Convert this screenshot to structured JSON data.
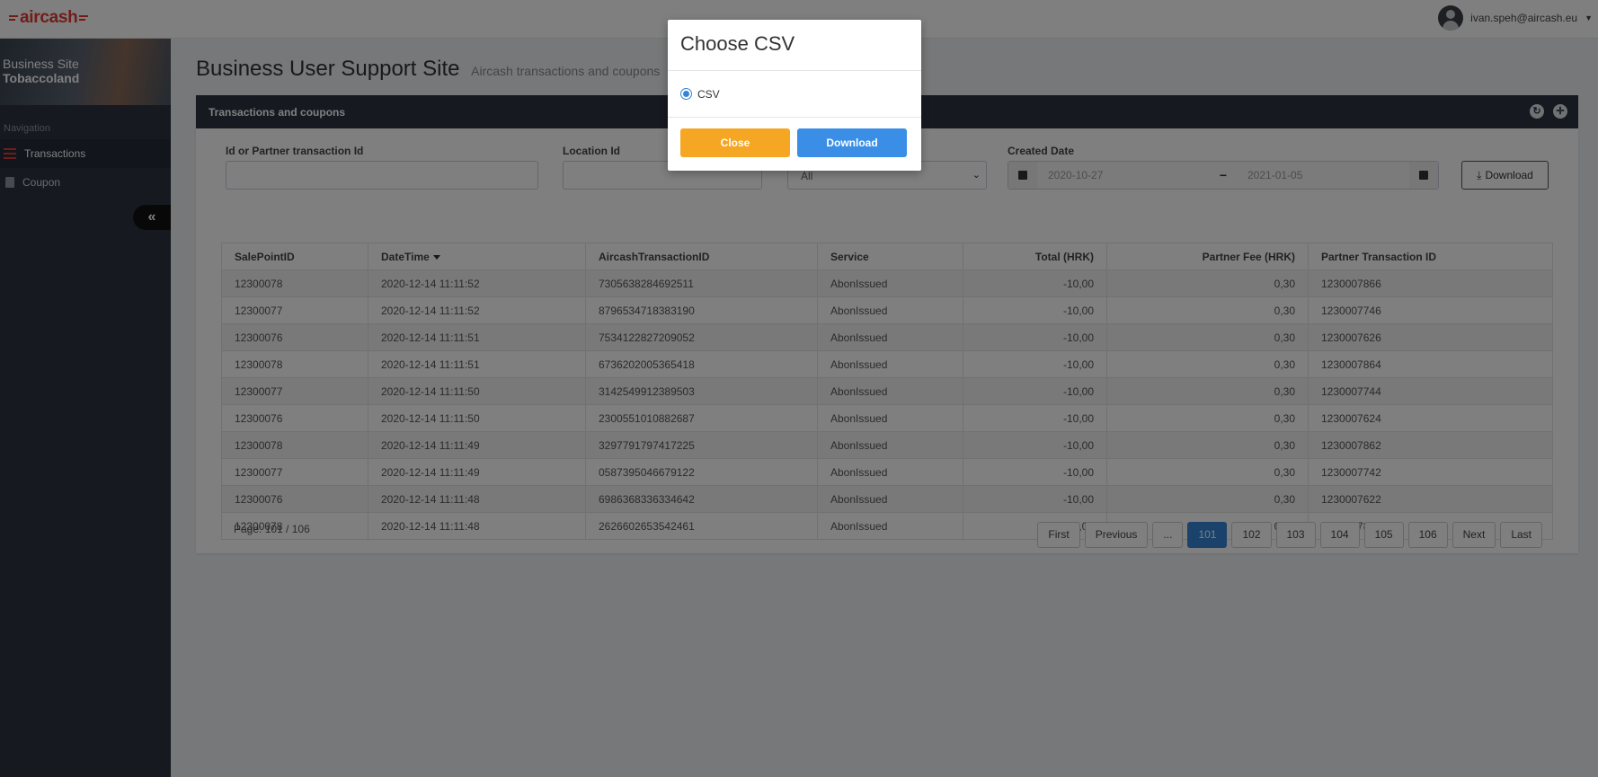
{
  "app": {
    "logo_text": "aircash",
    "user_email": "ivan.speh@aircash.eu"
  },
  "sidebar": {
    "site_line1": "Business Site",
    "site_line2": "Tobaccoland",
    "nav_label": "Navigation",
    "items": [
      {
        "label": "Transactions",
        "icon": "list-icon"
      },
      {
        "label": "Coupon",
        "icon": "document-icon"
      }
    ],
    "collapse_glyph": "«"
  },
  "page": {
    "title": "Business User Support Site",
    "subtitle": "Aircash transactions and coupons"
  },
  "card": {
    "title": "Transactions and coupons"
  },
  "filters": {
    "id_label": "Id or Partner transaction Id",
    "id_value": "",
    "location_label": "Location Id",
    "location_value": "",
    "service_value": "All",
    "date_label": "Created Date",
    "date_from": "2020-10-27",
    "date_to": "2021-01-05",
    "download_label": "Download"
  },
  "table": {
    "columns": [
      "SalePointID",
      "DateTime",
      "AircashTransactionID",
      "Service",
      "Total (HRK)",
      "Partner Fee (HRK)",
      "Partner Transaction ID"
    ],
    "rows": [
      [
        "12300078",
        "2020-12-14 11:11:52",
        "7305638284692511",
        "AbonIssued",
        "-10,00",
        "0,30",
        "1230007866"
      ],
      [
        "12300077",
        "2020-12-14 11:11:52",
        "8796534718383190",
        "AbonIssued",
        "-10,00",
        "0,30",
        "1230007746"
      ],
      [
        "12300076",
        "2020-12-14 11:11:51",
        "7534122827209052",
        "AbonIssued",
        "-10,00",
        "0,30",
        "1230007626"
      ],
      [
        "12300078",
        "2020-12-14 11:11:51",
        "6736202005365418",
        "AbonIssued",
        "-10,00",
        "0,30",
        "1230007864"
      ],
      [
        "12300077",
        "2020-12-14 11:11:50",
        "3142549912389503",
        "AbonIssued",
        "-10,00",
        "0,30",
        "1230007744"
      ],
      [
        "12300076",
        "2020-12-14 11:11:50",
        "2300551010882687",
        "AbonIssued",
        "-10,00",
        "0,30",
        "1230007624"
      ],
      [
        "12300078",
        "2020-12-14 11:11:49",
        "3297791797417225",
        "AbonIssued",
        "-10,00",
        "0,30",
        "1230007862"
      ],
      [
        "12300077",
        "2020-12-14 11:11:49",
        "0587395046679122",
        "AbonIssued",
        "-10,00",
        "0,30",
        "1230007742"
      ],
      [
        "12300076",
        "2020-12-14 11:11:48",
        "6986368336334642",
        "AbonIssued",
        "-10,00",
        "0,30",
        "1230007622"
      ],
      [
        "12300078",
        "2020-12-14 11:11:48",
        "2626602653542461",
        "AbonIssued",
        "-10,00",
        "0,30",
        "1230007860"
      ]
    ]
  },
  "pagination": {
    "info": "Page: 101 / 106",
    "buttons": [
      "First",
      "Previous",
      "...",
      "101",
      "102",
      "103",
      "104",
      "105",
      "106",
      "Next",
      "Last"
    ],
    "active": "101"
  },
  "modal": {
    "title": "Choose CSV",
    "option_label": "CSV",
    "close_label": "Close",
    "download_label": "Download"
  },
  "colors": {
    "brand": "#e53935",
    "primary": "#3a8ee6",
    "warning": "#f5a623",
    "sidebar": "#2c3441"
  }
}
